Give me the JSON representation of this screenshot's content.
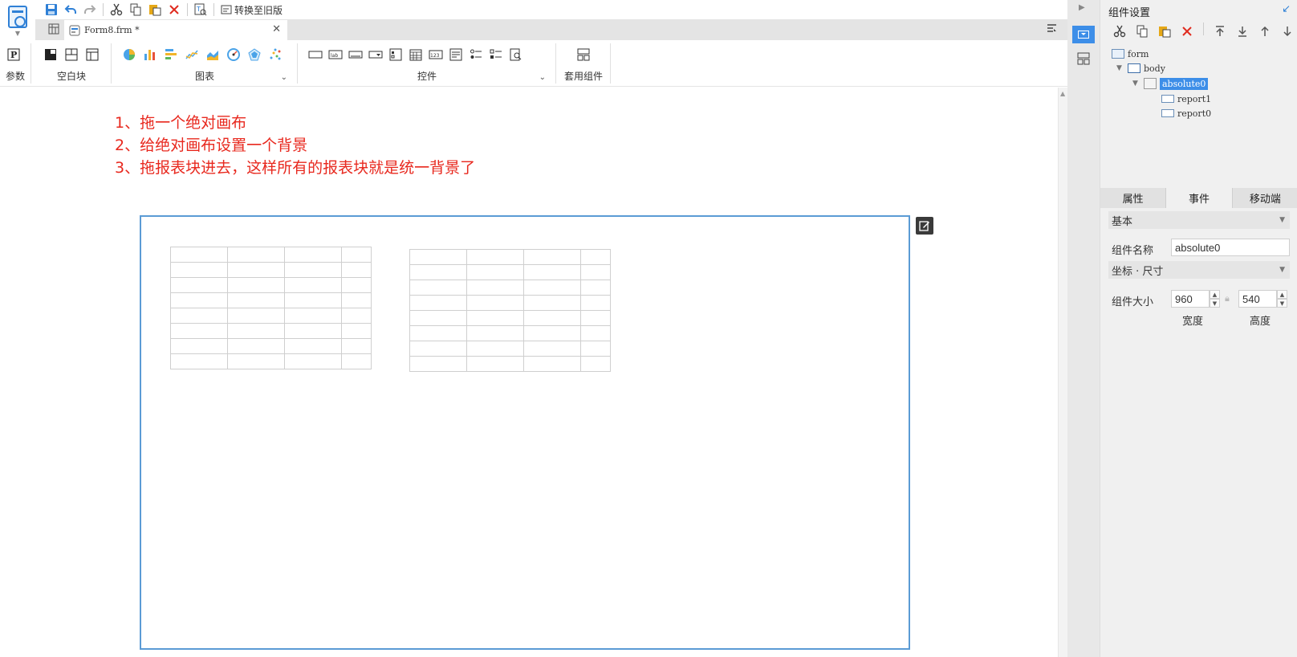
{
  "quick_toolbar": {
    "convert_label": "转换至旧版"
  },
  "tab": {
    "file_name": "Form8.frm *"
  },
  "ribbon": {
    "groups": {
      "params": "参数",
      "blank": "空白块",
      "charts": "图表",
      "controls": "控件",
      "templates": "套用组件"
    }
  },
  "canvas": {
    "notes": [
      "1、拖一个绝对画布",
      "2、给绝对画布设置一个背景",
      "3、拖报表块进去，这样所有的报表块就是统一背景了"
    ]
  },
  "settings": {
    "title": "组件设置",
    "tree": {
      "form": "form",
      "body": "body",
      "absolute": "absolute0",
      "report1": "report1",
      "report0": "report0"
    },
    "tabs": [
      "属性",
      "事件",
      "移动端"
    ],
    "sections": {
      "basic": "基本",
      "coords": "坐标 · 尺寸"
    },
    "name_label": "组件名称",
    "name_value": "absolute0",
    "size_label": "组件大小",
    "width_value": "960",
    "height_value": "540",
    "width_label": "宽度",
    "height_label": "高度"
  },
  "colors": {
    "accent": "#3d8ee8",
    "note_text": "#e8281e",
    "frame_border": "#5b9bd5"
  }
}
